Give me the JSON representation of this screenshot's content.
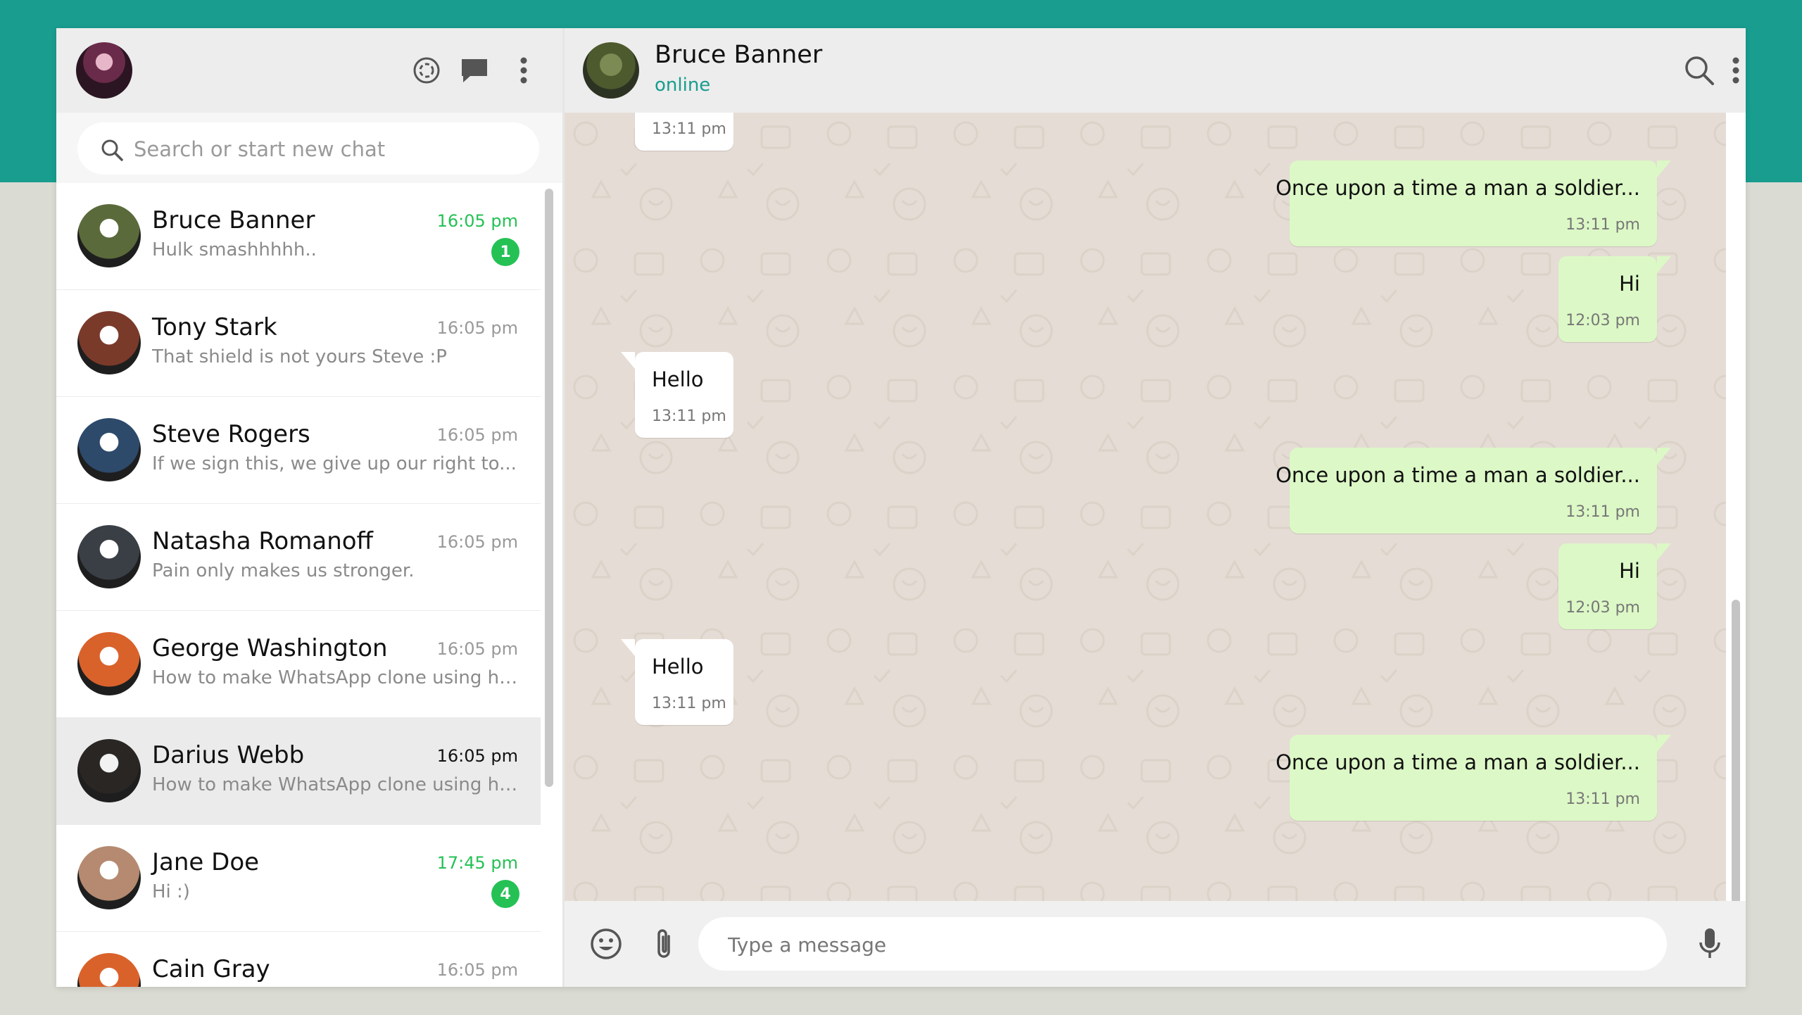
{
  "sidebar": {
    "search_placeholder": "Search or start new chat",
    "chats": [
      {
        "name": "Bruce Banner",
        "preview": "Hulk smashhhhh..",
        "time": "16:05 pm",
        "unread": "1",
        "avatar": "hulk-avatar",
        "color": "#5b6a3a"
      },
      {
        "name": "Tony Stark",
        "preview": "That shield is not yours Steve :P",
        "time": "16:05 pm",
        "avatar": "iron-man-avatar",
        "color": "#7a3a2a"
      },
      {
        "name": "Steve Rogers",
        "preview": "If we sign this, we give up our right to...",
        "time": "16:05 pm",
        "avatar": "captain-america-avatar",
        "color": "#2d4a6b"
      },
      {
        "name": "Natasha Romanoff",
        "preview": "Pain only makes us stronger.",
        "time": "16:05 pm",
        "avatar": "black-widow-avatar",
        "color": "#3a3f46"
      },
      {
        "name": "George Washington",
        "preview": "How to make WhatsApp clone using html ...",
        "time": "16:05 pm",
        "avatar": "sunset-avatar",
        "color": "#d9622b"
      },
      {
        "name": "Darius Webb",
        "preview": "How to make WhatsApp clone using html ...",
        "time": "16:05 pm",
        "avatar": "man-avatar",
        "color": "#2a2624"
      },
      {
        "name": "Jane Doe",
        "preview": "Hi :)",
        "time": "17:45 pm",
        "unread": "4",
        "avatar": "woman-avatar",
        "color": "#b58a70"
      },
      {
        "name": "Cain Gray",
        "preview": "",
        "time": "16:05 pm",
        "avatar": "sunset-avatar",
        "color": "#d9622b"
      }
    ]
  },
  "header": {
    "contact_name": "Bruce Banner",
    "contact_status": "online"
  },
  "messages": [
    {
      "dir": "in",
      "text": "",
      "time": "13:11 pm"
    },
    {
      "dir": "out",
      "text": "Once upon a time a man a soldier...",
      "time": "13:11 pm"
    },
    {
      "dir": "out",
      "text": "Hi",
      "time": "12:03 pm"
    },
    {
      "dir": "in",
      "text": "Hello",
      "time": "13:11 pm"
    },
    {
      "dir": "out",
      "text": "Once upon a time a man a soldier...",
      "time": "13:11 pm"
    },
    {
      "dir": "out",
      "text": "Hi",
      "time": "12:03 pm"
    },
    {
      "dir": "in",
      "text": "Hello",
      "time": "13:11 pm"
    },
    {
      "dir": "out",
      "text": "Once upon a time a man a soldier...",
      "time": "13:11 pm"
    }
  ],
  "composer": {
    "placeholder": "Type a message"
  },
  "colors": {
    "accent": "#189d8f",
    "unread": "#25c155",
    "outgoing_bubble": "#dcf8c6",
    "chat_background": "#e5ddd5"
  }
}
